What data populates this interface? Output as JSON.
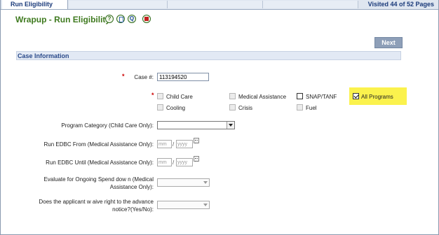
{
  "tabs": {
    "active_label": "Run Eligibility",
    "visited": "Visited 44 of 52 Pages"
  },
  "header": {
    "title": "Wrapup - Run Eligibility",
    "icons": [
      "help-icon",
      "document-icon",
      "search-icon",
      "stop-icon"
    ],
    "icon_glyphs": {
      "help": "?",
      "find": "Q"
    }
  },
  "toolbar": {
    "next_label": "Next"
  },
  "section": {
    "title": "Case Information"
  },
  "case": {
    "label": "Case #:",
    "value": "113194520"
  },
  "programs": [
    {
      "label": "Child Care",
      "checked": false,
      "enabled": false
    },
    {
      "label": "Medical Assistance",
      "checked": false,
      "enabled": false
    },
    {
      "label": "SNAP/TANF",
      "checked": false,
      "enabled": true
    },
    {
      "label": "All Programs",
      "checked": true,
      "enabled": true
    },
    {
      "label": "Cooling",
      "checked": false,
      "enabled": false
    },
    {
      "label": "Crisis",
      "checked": false,
      "enabled": false
    },
    {
      "label": "Fuel",
      "checked": false,
      "enabled": false
    }
  ],
  "fields": {
    "program_category": {
      "label": "Program Category (Child Care Only):"
    },
    "edbc_from": {
      "label": "Run EDBC From (Medical Assistance Only):",
      "mm": "mm",
      "yyyy": "yyyy",
      "slash": "/"
    },
    "edbc_until": {
      "label": "Run EDBC Until (Medical Assistance Only):",
      "mm": "mm",
      "yyyy": "yyyy",
      "slash": "/"
    },
    "spend_down": {
      "label_line1": "Evaluate for Ongoing Spend dow n (Medical",
      "label_line2": "Assistance Only):"
    },
    "waive_notice": {
      "label_line1": "Does the applicant w aive right to the advance",
      "label_line2": "notice?(Yes/No):"
    }
  },
  "required_mark": "*",
  "colors": {
    "title": "#3f7a1f",
    "section_bg": "#e2e9f4",
    "highlight": "#fbf24d",
    "required": "#cc0000"
  }
}
